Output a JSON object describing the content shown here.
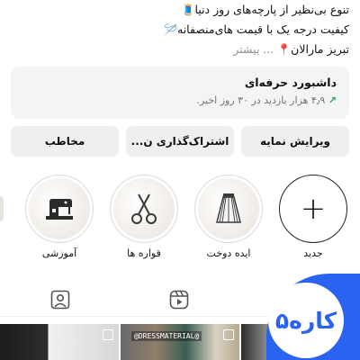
{
  "bio": {
    "line1_text": "تنوع بی‌نظیر از پارچه‌های روز دنیا",
    "line1_emoji": "🧵",
    "line2_text": "کیفیت درجه یک با قیمت های‌منصفانه",
    "line2_emoji": "🪡",
    "line3_text": "تبریز مارالان",
    "line3_emoji": "📍",
    "more": "... بیشتر"
  },
  "dashboard": {
    "title": "داشبورد حرفه‌ای",
    "subtitle": "۴٫۹ هزار بازدید در ۳۰ روز اخیر.",
    "arrow": "↗"
  },
  "buttons": {
    "edit": "ویرایش نمایه",
    "share": "اشتراک‌گذاری ن...",
    "contact": "مخاطب"
  },
  "highlights": {
    "new_label": "جدید",
    "new_icon": "+",
    "items": [
      {
        "label": "ایده دوخت",
        "icon": "skirt-icon"
      },
      {
        "label": "قواره ها",
        "icon": "scissors-icon"
      },
      {
        "label": "آموزشی",
        "icon": "sewing-machine-icon"
      }
    ]
  },
  "tabs": [
    "reels-tab",
    "tagged-tab"
  ],
  "grid": {
    "tag_text": "@DRESSMATERIAL@"
  },
  "brand": {
    "text": "کاره۵"
  },
  "colors": {
    "accent": "#2a63f0",
    "trend": "#21a05a",
    "button_bg": "#efefef",
    "card_bg": "#f3f4f6",
    "muted": "#737373"
  }
}
